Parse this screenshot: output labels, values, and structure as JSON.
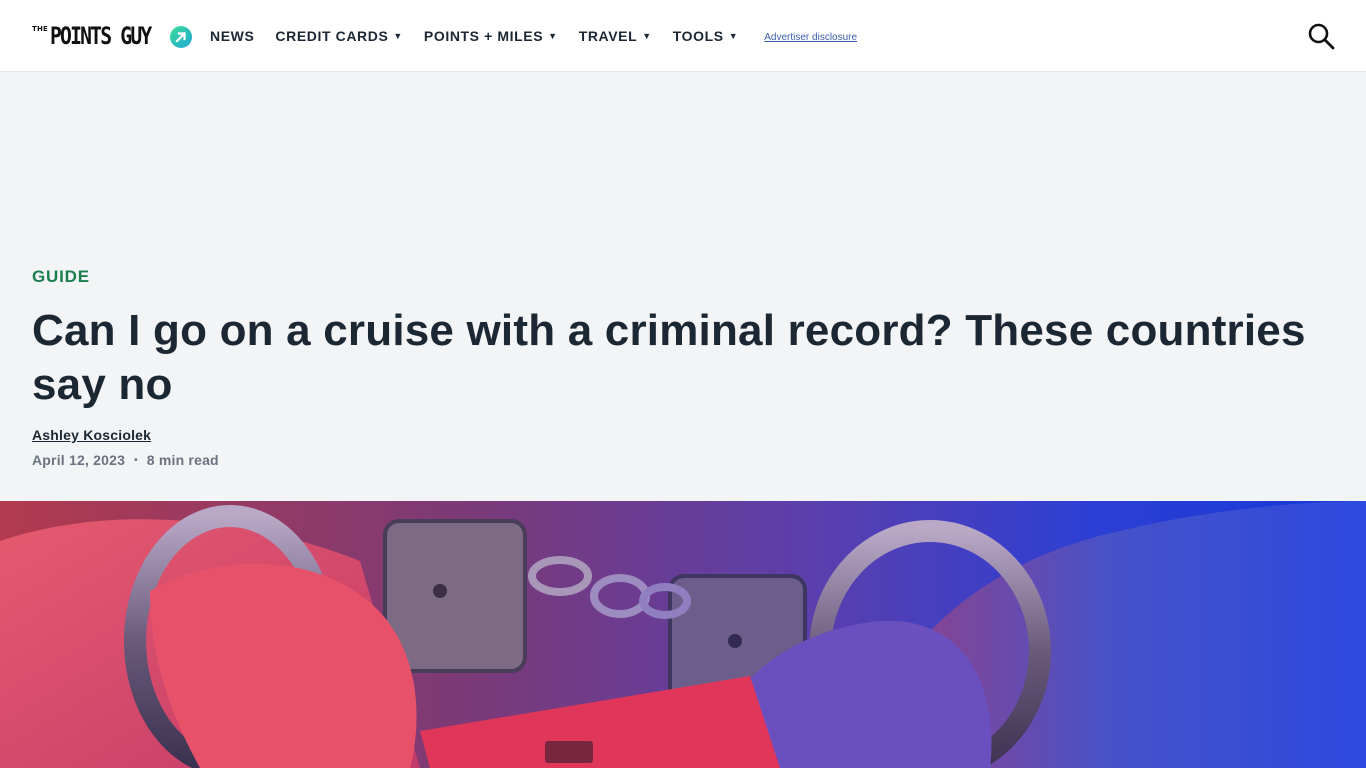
{
  "header": {
    "logo": {
      "small_text": "THE",
      "main_text": "POINTS GUY"
    },
    "nav": [
      {
        "label": "NEWS",
        "has_dropdown": false
      },
      {
        "label": "CREDIT CARDS",
        "has_dropdown": true
      },
      {
        "label": "POINTS + MILES",
        "has_dropdown": true
      },
      {
        "label": "TRAVEL",
        "has_dropdown": true
      },
      {
        "label": "TOOLS",
        "has_dropdown": true
      }
    ],
    "dropdown_caret": "▼",
    "disclosure": "Advertiser disclosure",
    "search_icon": "search-icon"
  },
  "article": {
    "category": "GUIDE",
    "title": "Can I go on a cruise with a criminal record? These countries say no",
    "author": "Ashley Kosciolek",
    "date": "April 12, 2023",
    "separator": "•",
    "read_time": "8 min read"
  },
  "colors": {
    "accent_green": "#1a7f4d",
    "hero_bg": "#f3f4f6",
    "text_dark": "#1b2733",
    "meta_gray": "#6b7280",
    "link_blue": "#3b5fb0"
  }
}
